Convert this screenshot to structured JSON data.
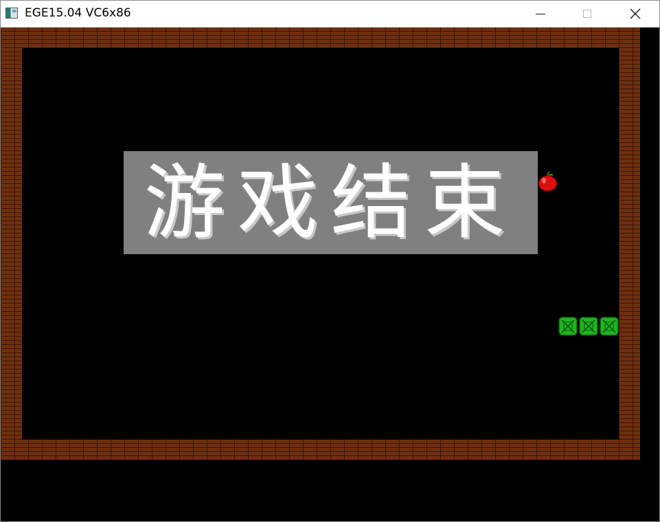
{
  "window": {
    "title": "EGE15.04 VC6x86"
  },
  "game": {
    "banner_text": "游戏结束",
    "snake_segments": 3,
    "colors": {
      "brick": "#6e2f0f",
      "mortar": "#3a1505",
      "banner_bg": "#808080",
      "snake": "#1fb51f",
      "apple": "#e01010"
    },
    "icons": [
      "app-icon",
      "minimize-icon",
      "maximize-icon",
      "close-icon",
      "apple-icon",
      "snake-segment-icon"
    ]
  }
}
